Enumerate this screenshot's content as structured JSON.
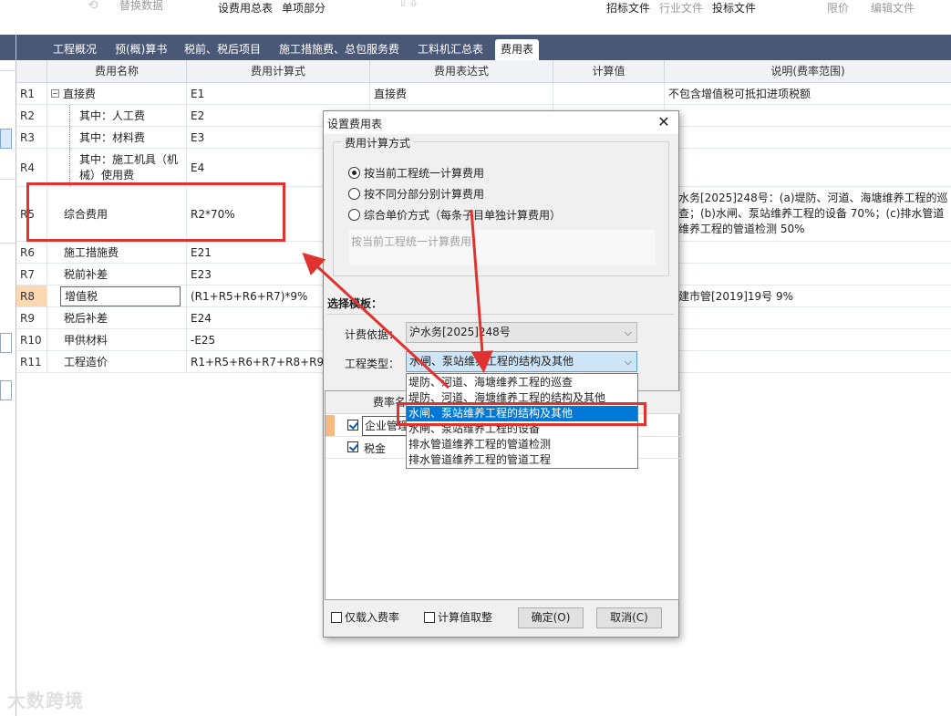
{
  "ribbon": {
    "replace_data": "替换数据",
    "set_fee_summary": "设费用总表",
    "unit_item_part": "单项部分",
    "bid_file": "招标文件",
    "industry_file": "行业文件",
    "tender_file": "投标文件",
    "limit_price": "限价",
    "edit_file": "编辑文件"
  },
  "tabs": [
    {
      "label": "工程概况"
    },
    {
      "label": "预(概)算书"
    },
    {
      "label": "税前、税后项目"
    },
    {
      "label": "施工措施费、总包服务费"
    },
    {
      "label": "工料机汇总表"
    },
    {
      "label": "费用表",
      "active": true
    }
  ],
  "grid": {
    "headers": [
      "费用名称",
      "费用计算式",
      "费用表达式",
      "计算值",
      "说明(费率范围)"
    ],
    "rows": [
      {
        "id": "R1",
        "name": "直接费",
        "calc": "E1",
        "expr": "直接费",
        "value": "",
        "note": "不包含增值税可抵扣进项税额"
      },
      {
        "id": "R2",
        "name": "其中：人工费",
        "calc": "E2",
        "expr": "",
        "value": "",
        "note": ""
      },
      {
        "id": "R3",
        "name": "其中：材料费",
        "calc": "E3",
        "expr": "",
        "value": "",
        "note": ""
      },
      {
        "id": "R4",
        "name": "其中：施工机具（机械）使用费",
        "calc": "E4",
        "expr": "",
        "value": "",
        "note": ""
      },
      {
        "id": "R5",
        "name": "综合费用",
        "calc": "R2*70%",
        "expr": "",
        "value": "",
        "note": "水务[2025]248号：(a)堤防、河道、海塘维养工程的巡查；(b)水闸、泵站维养工程的设备 70%；(c)排水管道维养工程的管道检测 50%"
      },
      {
        "id": "R6",
        "name": "施工措施费",
        "calc": "E21",
        "expr": "",
        "value": "",
        "note": ""
      },
      {
        "id": "R7",
        "name": "税前补差",
        "calc": "E23",
        "expr": "",
        "value": "",
        "note": ""
      },
      {
        "id": "R8",
        "name": "增值税",
        "calc": "(R1+R5+R6+R7)*9%",
        "expr": "",
        "value": "",
        "note": "建市管[2019]19号 9%"
      },
      {
        "id": "R9",
        "name": "税后补差",
        "calc": "E24",
        "expr": "",
        "value": "",
        "note": ""
      },
      {
        "id": "R10",
        "name": "甲供材料",
        "calc": "-E25",
        "expr": "",
        "value": "",
        "note": ""
      },
      {
        "id": "R11",
        "name": "工程造价",
        "calc": "R1+R5+R6+R7+R8+R9+",
        "expr": "",
        "value": "",
        "note": ""
      }
    ]
  },
  "dialog": {
    "title": "设置费用表",
    "method_group": "费用计算方式",
    "methods": [
      {
        "label": "按当前工程统一计算费用",
        "selected": true
      },
      {
        "label": "按不同分部分别计算费用",
        "selected": false
      },
      {
        "label": "综合单价方式（每条子目单独计算费用）",
        "selected": false
      }
    ],
    "method_desc": "按当前工程统一计算费用",
    "template_section": "选择模板：",
    "basis_label": "计费依据：",
    "basis_value": "沪水务[2025]248号",
    "type_label": "工程类型：",
    "type_value": "水闸、泵站维养工程的结构及其他",
    "type_options": [
      "堤防、河道、海塘维养工程的巡查",
      "堤防、河道、海塘维养工程的结构及其他",
      "水闸、泵站维养工程的结构及其他",
      "水闸、泵站维养工程的设备",
      "排水管道维养工程的管道检测",
      "排水管道维养工程的管道工程"
    ],
    "list_header": "费率名",
    "list_items": [
      {
        "label": "企业管理",
        "checked": true
      },
      {
        "label": "税金",
        "checked": true
      }
    ],
    "only_rate": "仅载入费率",
    "round_value": "计算值取整",
    "ok": "确定(O)",
    "cancel": "取消(C)"
  },
  "watermark": "大数跨境",
  "colors": {
    "tabbar": "#4a5878",
    "highlight": "#0078d7",
    "annotation": "#e0322f"
  }
}
